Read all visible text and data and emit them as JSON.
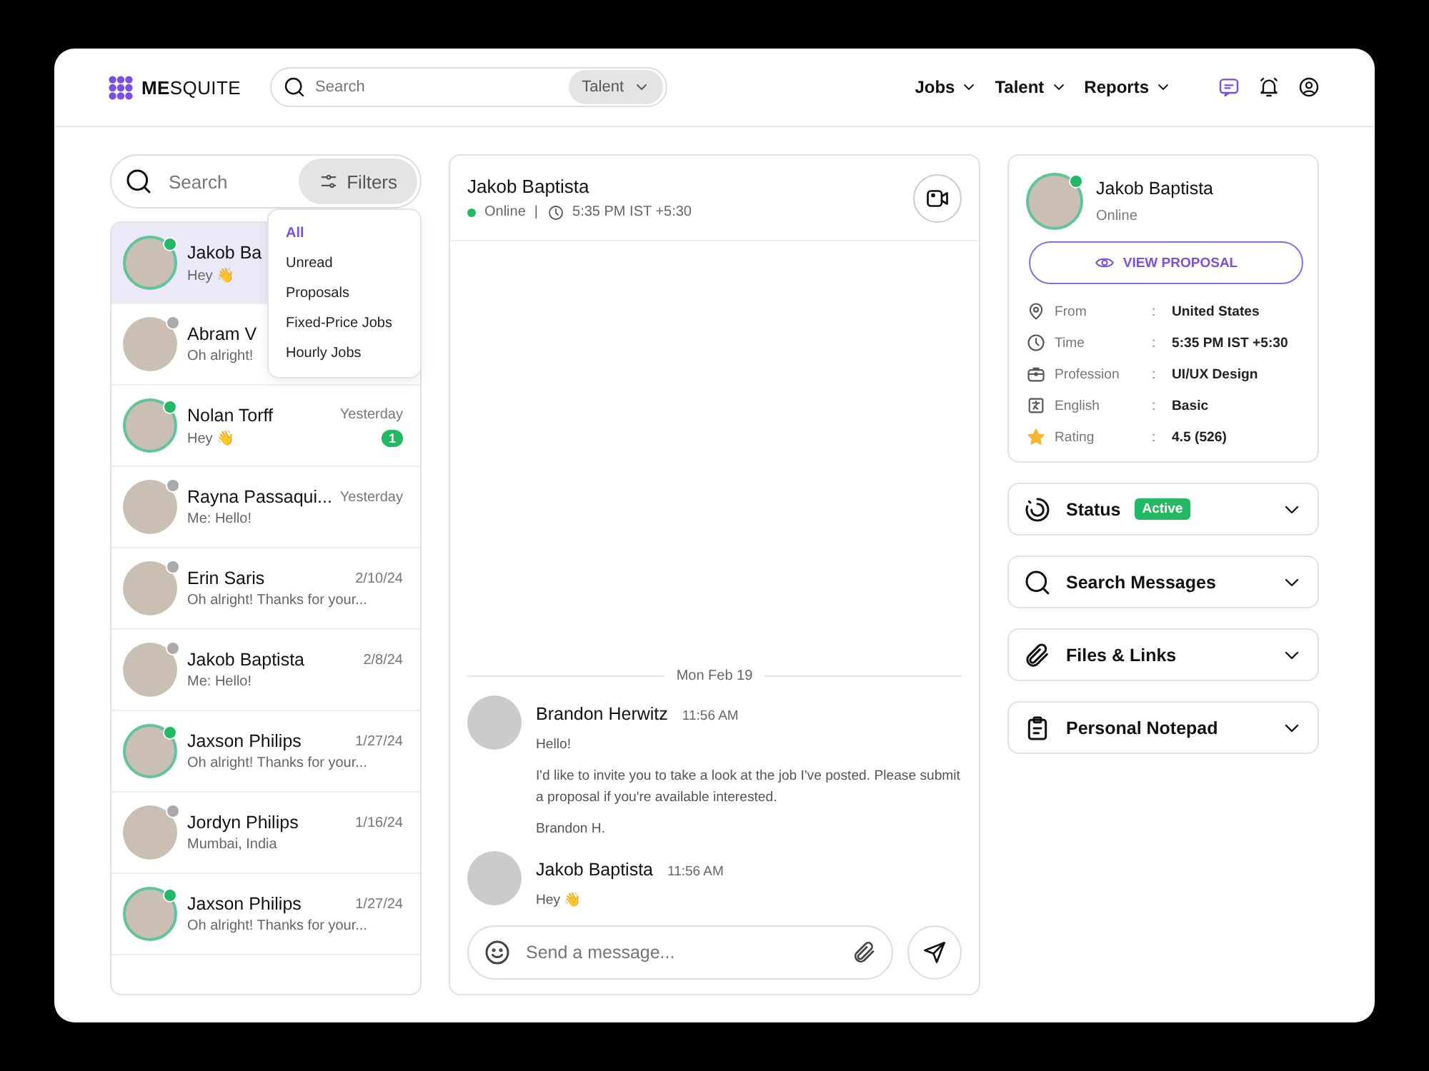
{
  "header": {
    "logo": "**ME**SQUITE",
    "search": {
      "placeholder": "Search",
      "scope": "Talent"
    },
    "nav": [
      {
        "label": "Jobs"
      },
      {
        "label": "Talent"
      },
      {
        "label": "Reports"
      }
    ]
  },
  "conversations": {
    "search": {
      "placeholder": "Search"
    },
    "filter_button": "Filters",
    "filter_menu": [
      {
        "label": "All",
        "selected": true
      },
      {
        "label": "Unread",
        "selected": false
      },
      {
        "label": "Proposals",
        "selected": false
      },
      {
        "label": "Fixed-Price Jobs",
        "selected": false
      },
      {
        "label": "Hourly Jobs",
        "selected": false
      }
    ],
    "items": [
      {
        "name": "Jakob Ba",
        "preview": "Hey 👋",
        "online": true,
        "selected": true
      },
      {
        "name": "Abram V",
        "preview": "Oh alright!",
        "online": false,
        "selected": false
      },
      {
        "name": "Nolan Torff",
        "preview": "Hey 👋",
        "time": "Yesterday",
        "unread": "1",
        "online": true,
        "selected": false
      },
      {
        "name": "Rayna Passaqui...",
        "preview": "Me: Hello!",
        "time": "Yesterday",
        "online": false,
        "selected": false
      },
      {
        "name": "Erin Saris",
        "preview": "Oh alright! Thanks for your...",
        "time": "2/10/24",
        "online": false,
        "selected": false
      },
      {
        "name": "Jakob Baptista",
        "preview": "Me: Hello!",
        "time": "2/8/24",
        "online": false,
        "selected": false
      },
      {
        "name": "Jaxson Philips",
        "preview": "Oh alright! Thanks for your...",
        "time": "1/27/24",
        "online": true,
        "selected": false
      },
      {
        "name": "Jordyn Philips",
        "preview": "Mumbai, India",
        "time": "1/16/24",
        "online": false,
        "selected": false
      },
      {
        "name": "Jaxson Philips",
        "preview": "Oh alright! Thanks for your...",
        "time": "1/27/24",
        "online": true,
        "selected": false
      }
    ]
  },
  "chat": {
    "name": "Jakob Baptista",
    "status": "Online",
    "online": true,
    "divider": "|",
    "local_time": "5:35 PM IST +5:30",
    "date_divider": "Mon Feb 19",
    "messages": [
      {
        "sender": "Brandon Herwitz",
        "time": "11:56 AM",
        "paragraphs": [
          "Hello!",
          "I'd like to invite you to take a look at the job I've posted. Please submit a proposal if you're available interested.",
          "Brandon H."
        ]
      },
      {
        "sender": "Jakob Baptista",
        "time": "11:56 AM",
        "paragraphs": [
          "Hey 👋"
        ]
      }
    ],
    "composer": {
      "placeholder": "Send a message..."
    }
  },
  "profile": {
    "name": "Jakob Baptista",
    "status": "Online",
    "online": true,
    "button": "VIEW PROPOSAL",
    "details": [
      {
        "kind": "location",
        "label": "From",
        "sep": ":",
        "value": "United States"
      },
      {
        "kind": "time",
        "label": "Time",
        "sep": ":",
        "value": "5:35 PM IST +5:30"
      },
      {
        "kind": "profession",
        "label": "Profession",
        "sep": ":",
        "value": "UI/UX Design"
      },
      {
        "kind": "language",
        "label": "English",
        "sep": ":",
        "value": "Basic"
      },
      {
        "kind": "rating",
        "label": "Rating",
        "sep": ":",
        "value": "4.5 (526)"
      }
    ]
  },
  "panels": [
    {
      "kind": "status",
      "title": "Status",
      "badge": "Active"
    },
    {
      "kind": "search",
      "title": "Search Messages"
    },
    {
      "kind": "files",
      "title": "Files & Links"
    },
    {
      "kind": "notepad",
      "title": "Personal Notepad"
    }
  ]
}
